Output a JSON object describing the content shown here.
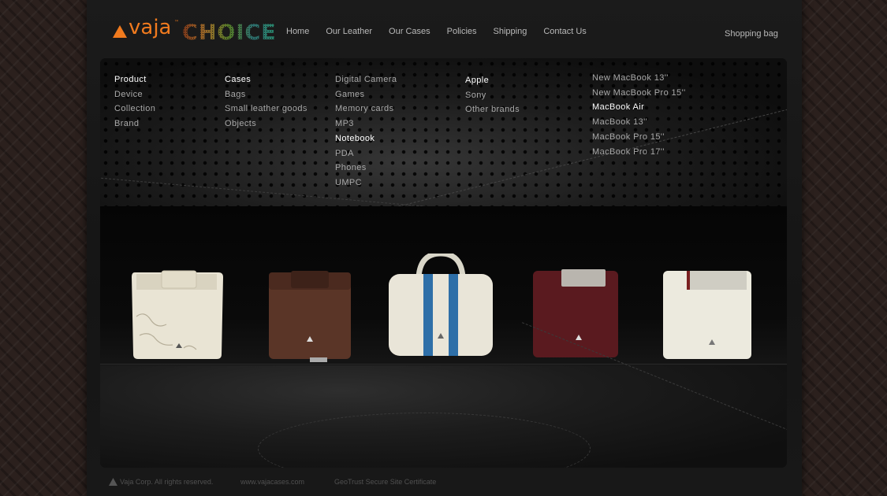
{
  "brand": {
    "logo_text": "vaja",
    "logo_tm": "™",
    "logo_sub": "CHOICE"
  },
  "nav": {
    "items": [
      "Home",
      "Our Leather",
      "Our Cases",
      "Policies",
      "Shipping",
      "Contact Us"
    ],
    "shopping_bag": "Shopping bag"
  },
  "menu": {
    "col1": [
      "Product",
      "Device",
      "Collection",
      "Brand"
    ],
    "col2": [
      "Cases",
      "Bags",
      "Small leather goods",
      "Objects"
    ],
    "col3": [
      "Digital Camera",
      "Games",
      "Memory cards",
      "MP3",
      "Notebook",
      "PDA",
      "Phones",
      "UMPC"
    ],
    "col4": [
      "Apple",
      "Sony",
      "Other brands"
    ],
    "col5": [
      "New MacBook 13''",
      "New MacBook Pro 15''",
      "MacBook Air",
      "MacBook 13''",
      "MacBook Pro 15''",
      "MacBook Pro 17''"
    ]
  },
  "carousel": {
    "products": [
      "cream-floral-laptop-case",
      "brown-laptop-case",
      "cream-blue-stripe-laptop-bag",
      "burgundy-laptop-case",
      "white-laptop-sleeve"
    ],
    "next_icon": "arrow-right-icon"
  },
  "footer": {
    "copyright": "Vaja Corp. All rights reserved.",
    "website": "www.vajacases.com",
    "certificate": "GeoTrust Secure Site Certificate"
  },
  "colors": {
    "accent": "#f07a1e",
    "text": "#b9b9b9",
    "active": "#ffffff"
  }
}
